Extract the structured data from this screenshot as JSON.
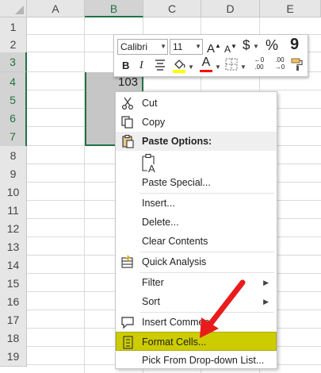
{
  "sheet": {
    "columns": [
      "A",
      "B",
      "C",
      "D",
      "E"
    ],
    "rows": [
      "1",
      "2",
      "3",
      "4",
      "5",
      "6",
      "7",
      "8",
      "9",
      "10",
      "11",
      "12",
      "13",
      "14",
      "15",
      "16",
      "17",
      "18",
      "19"
    ],
    "active_cell_value": "103",
    "selection_color": "#217346"
  },
  "mini_toolbar": {
    "font_name": "Calibri",
    "font_size": "11",
    "grow_font": "A",
    "shrink_font": "A",
    "currency": "$",
    "percent": "%",
    "comma": "9",
    "bold": "B",
    "italic": "I",
    "font_color_letter": "A",
    "decimal_increase_top": "←0",
    "decimal_increase_bottom": ".00",
    "decimal_decrease_top": ".00",
    "decimal_decrease_bottom": "→0",
    "fill_color": "#ffff00",
    "font_color": "#ff0000"
  },
  "context_menu": {
    "cut": "Cut",
    "copy": "Copy",
    "paste_options": "Paste Options:",
    "paste_special": "Paste Special...",
    "insert": "Insert...",
    "delete": "Delete...",
    "clear_contents": "Clear Contents",
    "quick_analysis": "Quick Analysis",
    "filter": "Filter",
    "sort": "Sort",
    "insert_comment": "Insert Comment",
    "format_cells": "Format Cells...",
    "pick_from_list": "Pick From Drop-down List...",
    "highlight_color": "#cccc00",
    "arrow_color": "#e81c1c"
  }
}
